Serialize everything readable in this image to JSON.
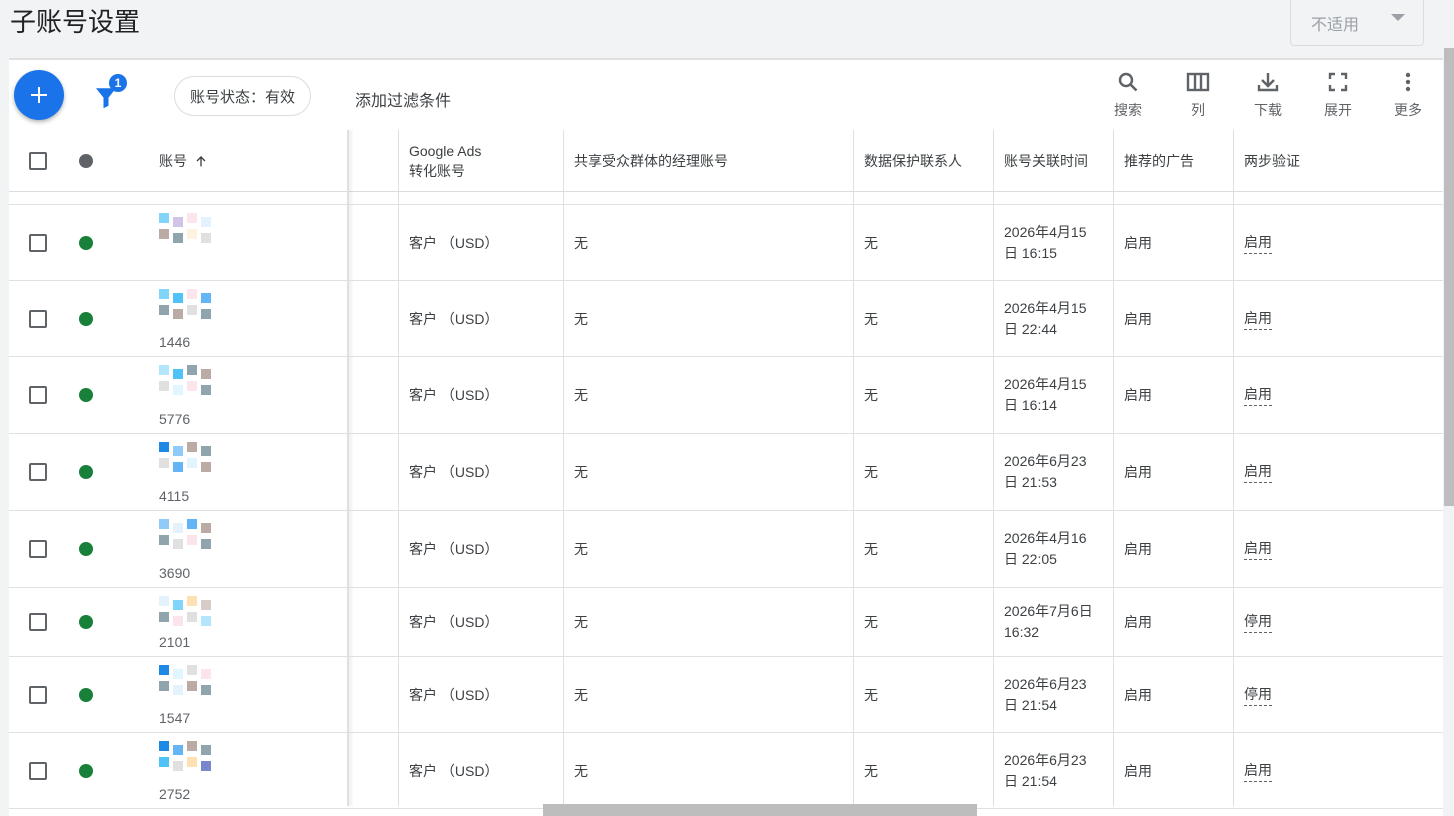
{
  "page_title": "子账号设置",
  "na_select": "不适用",
  "toolbar": {
    "filter_count": "1",
    "chip": "账号状态：有效",
    "add_filter": "添加过滤条件",
    "search": "搜索",
    "columns": "列",
    "download": "下载",
    "expand": "展开",
    "more": "更多"
  },
  "colors": {
    "accent": "#1a73e8",
    "status_green": "#188038",
    "status_grey": "#5f6368"
  },
  "table": {
    "headers": {
      "account": "账号",
      "conversion_line1": "Google Ads",
      "conversion_line2": "转化账号",
      "shared_manager": "共享受众群体的经理账号",
      "data_contact": "数据保护联系人",
      "linked_time": "账号关联时间",
      "recommended_ads": "推荐的广告",
      "two_step": "两步验证"
    },
    "rows": [
      {
        "num": "",
        "conversion": "客户 （USD）",
        "shared": "无",
        "contact": "无",
        "time1": "2026年4月15",
        "time2": "日 16:15",
        "ads": "启用",
        "twostep": "启用"
      },
      {
        "num": "1446",
        "conversion": "客户 （USD）",
        "shared": "无",
        "contact": "无",
        "time1": "2026年4月15",
        "time2": "日 22:44",
        "ads": "启用",
        "twostep": "启用"
      },
      {
        "num": "5776",
        "conversion": "客户 （USD）",
        "shared": "无",
        "contact": "无",
        "time1": "2026年4月15",
        "time2": "日 16:14",
        "ads": "启用",
        "twostep": "启用"
      },
      {
        "num": "4115",
        "conversion": "客户 （USD）",
        "shared": "无",
        "contact": "无",
        "time1": "2026年6月23",
        "time2": "日 21:53",
        "ads": "启用",
        "twostep": "启用"
      },
      {
        "num": "3690",
        "conversion": "客户 （USD）",
        "shared": "无",
        "contact": "无",
        "time1": "2026年4月16",
        "time2": "日 22:05",
        "ads": "启用",
        "twostep": "启用"
      },
      {
        "num": "2101",
        "conversion": "客户 （USD）",
        "shared": "无",
        "contact": "无",
        "time1": "2026年7月6日",
        "time2": "16:32",
        "ads": "启用",
        "twostep": "停用"
      },
      {
        "num": "1547",
        "conversion": "客户 （USD）",
        "shared": "无",
        "contact": "无",
        "time1": "2026年6月23",
        "time2": "日 21:54",
        "ads": "启用",
        "twostep": "停用"
      },
      {
        "num": "2752",
        "conversion": "客户 （USD）",
        "shared": "无",
        "contact": "无",
        "time1": "2026年6月23",
        "time2": "日 21:54",
        "ads": "启用",
        "twostep": "启用"
      }
    ]
  }
}
